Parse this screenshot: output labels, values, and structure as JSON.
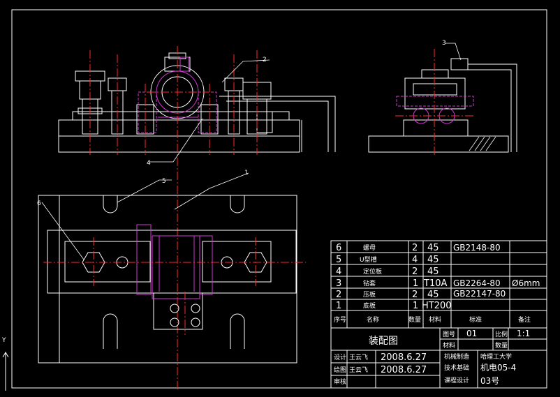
{
  "drawing": {
    "title": "装配图",
    "balloons": [
      "1",
      "2",
      "3",
      "4",
      "5",
      "6"
    ],
    "axis_label": "Y"
  },
  "parts_list": {
    "headers": [
      "序号",
      "名称",
      "数量",
      "材料",
      "标准",
      "备注"
    ],
    "rows": [
      {
        "no": "6",
        "name": "螺母",
        "qty": "2",
        "material": "45",
        "standard": "GB2148-80",
        "note": ""
      },
      {
        "no": "5",
        "name": "U型槽",
        "qty": "4",
        "material": "45",
        "standard": "",
        "note": ""
      },
      {
        "no": "4",
        "name": "定位板",
        "qty": "2",
        "material": "45",
        "standard": "",
        "note": ""
      },
      {
        "no": "3",
        "name": "钻套",
        "qty": "1",
        "material": "T10A",
        "standard": "GB2264-80",
        "note": "Ø6mm"
      },
      {
        "no": "2",
        "name": "压板",
        "qty": "2",
        "material": "45",
        "standard": "GB22147-80",
        "note": ""
      },
      {
        "no": "1",
        "name": "底板",
        "qty": "1",
        "material": "HT200",
        "standard": "",
        "note": ""
      }
    ]
  },
  "title_block": {
    "drawing_name": "装配图",
    "sheet_label": "图号",
    "sheet_value": "01",
    "scale_label": "比例",
    "scale_value": "1:1",
    "material_label": "材料",
    "qty_label": "数量",
    "designer_label": "设计",
    "designer_name": "王云飞",
    "designer_date": "2008.6.27",
    "checker_label": "绘图",
    "checker_name": "王云飞",
    "checker_date": "2008.6.27",
    "reviewer_label": "审核",
    "course_1": "机械制造",
    "course_2": "技术基础",
    "course_3": "课程设计",
    "school": "哈理工大学",
    "class_name": "机电05-4",
    "student_no": "03号"
  },
  "colors": {
    "background": "#000000",
    "lines": "#ffffff",
    "centerlines": "#ff2a2a",
    "hidden_parts": "#d23ad2",
    "leaders": "#ffffff"
  }
}
